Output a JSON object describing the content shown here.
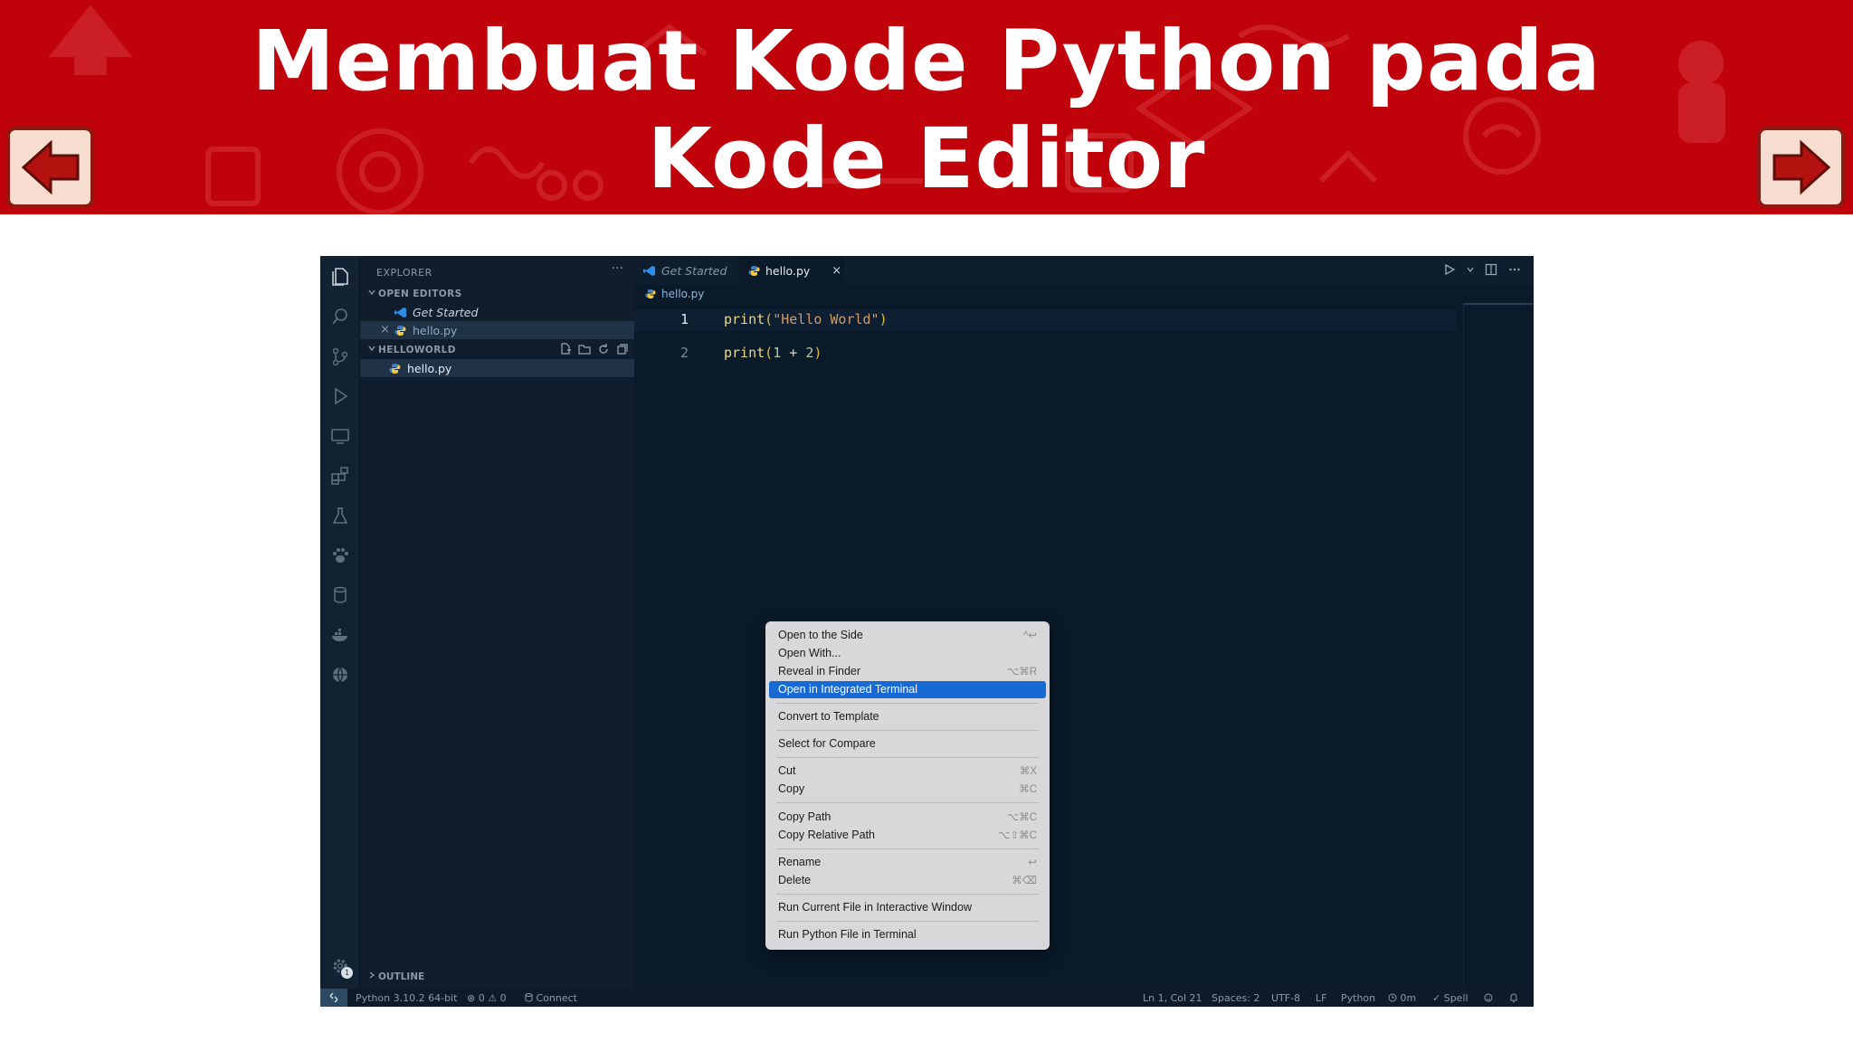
{
  "slide": {
    "title": "Membuat Kode Python pada Kode Editor",
    "colors": {
      "banner": "#c0020b",
      "nav_button": "#f7ddd0",
      "nav_border": "#8c1a12"
    },
    "nav": {
      "prev_icon": "left-arrow-icon",
      "next_icon": "right-arrow-icon"
    }
  },
  "sidebar": {
    "header": "EXPLORER",
    "more": "···",
    "open_editors": {
      "label": "OPEN EDITORS",
      "items": [
        {
          "label": "Get Started",
          "icon": "vscode-icon"
        },
        {
          "label": "hello.py",
          "icon": "python-icon",
          "close": "×"
        }
      ]
    },
    "folder": {
      "label": "HELLOWORLD",
      "items": [
        {
          "label": "hello.py",
          "icon": "python-icon"
        }
      ]
    },
    "outline_label": "OUTLINE"
  },
  "editor": {
    "tabs": [
      {
        "label": "Get Started",
        "icon": "vscode-icon",
        "active": false
      },
      {
        "label": "hello.py",
        "icon": "python-icon",
        "active": true,
        "close": "×"
      }
    ],
    "breadcrumb": "hello.py",
    "lines": [
      {
        "num": "1",
        "fn": "print",
        "open": "(",
        "arg": "\"Hello World\"",
        "close": ")"
      },
      {
        "num": "2",
        "fn": "print",
        "open": "(",
        "arg_a": "1",
        "op": " + ",
        "arg_b": "2",
        "close": ")"
      }
    ]
  },
  "context_menu": {
    "items": [
      {
        "label": "Open to the Side",
        "shortcut": "^↩"
      },
      {
        "label": "Open With...",
        "shortcut": ""
      },
      {
        "label": "Reveal in Finder",
        "shortcut": "⌥⌘R"
      },
      {
        "label": "Open in Integrated Terminal",
        "shortcut": "",
        "highlighted": true
      },
      {
        "label": "Convert to Template",
        "shortcut": ""
      },
      {
        "label": "Select for Compare",
        "shortcut": ""
      },
      {
        "label": "Cut",
        "shortcut": "⌘X"
      },
      {
        "label": "Copy",
        "shortcut": "⌘C"
      },
      {
        "label": "Copy Path",
        "shortcut": "⌥⌘C"
      },
      {
        "label": "Copy Relative Path",
        "shortcut": "⌥⇧⌘C"
      },
      {
        "label": "Rename",
        "shortcut": "↩"
      },
      {
        "label": "Delete",
        "shortcut": "⌘⌫"
      },
      {
        "label": "Run Current File in Interactive Window",
        "shortcut": ""
      },
      {
        "label": "Run Python File in Terminal",
        "shortcut": ""
      }
    ]
  },
  "status_bar": {
    "interpreter": "Python 3.10.2 64-bit",
    "problems": "⊗ 0 ⚠ 0",
    "connect": "Connect",
    "position": "Ln 1, Col 21",
    "spaces": "Spaces: 2",
    "encoding": "UTF-8",
    "eol": "LF",
    "language": "Python",
    "time": "0m",
    "spell": "✓ Spell"
  },
  "activity_icons": [
    "explorer-icon",
    "search-icon",
    "source-control-icon",
    "run-debug-icon",
    "remote-explorer-icon",
    "extensions-icon",
    "testing-icon",
    "paw-icon",
    "database-icon",
    "docker-icon",
    "globe-icon",
    "settings-gear-icon"
  ],
  "badge": "1"
}
